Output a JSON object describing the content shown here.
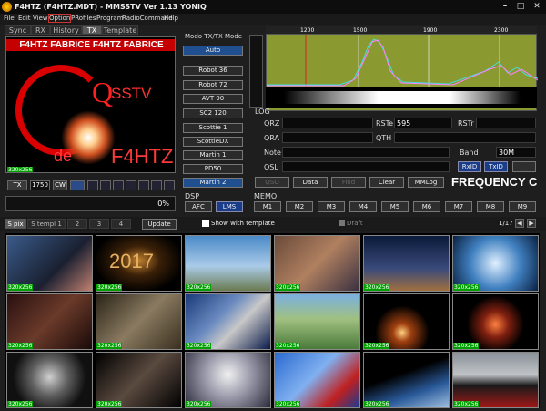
{
  "window": {
    "title": "F4HTZ (F4HTZ.MDT) - MMSSTV Ver 1.13 YONIQ",
    "min": "–",
    "max": "□",
    "close": "✕"
  },
  "menu": [
    "File",
    "Edit",
    "View",
    "Option",
    "PRofiles",
    "Program",
    "RadioCommand",
    "Help"
  ],
  "tabs": [
    "Sync",
    "RX",
    "History",
    "TX",
    "Template"
  ],
  "tx_image": {
    "banner": "F4HTZ  FABRICE  F4HTZ  FABRICE",
    "logo_q": "Q",
    "logo_sstv": "SSTV",
    "logo_de": "de",
    "callsign": "F4HTZ",
    "size": "320x256"
  },
  "tx_controls": {
    "tx": "TX",
    "freq": "1750",
    "cw": "CW",
    "percent": "0%"
  },
  "mode": {
    "title": "Modo TX/TX Mode",
    "items": [
      "Auto",
      "Robot 36",
      "Robot 72",
      "AVT 90",
      "SC2 120",
      "Scottie 1",
      "ScottieDX",
      "Martin 1",
      "PD50",
      "Martin 2"
    ],
    "selected": "Martin 2"
  },
  "spectrum": {
    "scale": [
      "1200",
      "1500",
      "1900",
      "2300"
    ]
  },
  "log": {
    "title": "LOG",
    "qrz_label": "QRZ",
    "rste_label": "RSTe",
    "rste_value": "595",
    "rstr_label": "RSTr",
    "qra_label": "QRA",
    "qth_label": "QTH",
    "note_label": "Note",
    "band_label": "Band",
    "band_value": "30M",
    "qsl_label": "QSL",
    "rxid": "RxID",
    "txid": "TxID"
  },
  "log_buttons": [
    "QSO",
    "Data",
    "Find",
    "Clear",
    "MMLog"
  ],
  "freq_banner": "FREQUENCY C",
  "dsp": {
    "title": "DSP",
    "afc": "AFC",
    "lms": "LMS"
  },
  "memo": {
    "title": "MEMO",
    "buttons": [
      "M1",
      "M2",
      "M3",
      "M4",
      "M5",
      "M6",
      "M7",
      "M8",
      "M9"
    ]
  },
  "bottom_tabs": [
    "S pix",
    "S templ 1",
    "2",
    "3",
    "4"
  ],
  "update": "Update",
  "show_template": "Show with template",
  "draft": "Draft",
  "page": "1/17",
  "thumbs": [
    {
      "size": "320x256"
    },
    {
      "size": "320x256"
    },
    {
      "size": "320x256"
    },
    {
      "size": "320x256"
    },
    {
      "size": "320x256"
    },
    {
      "size": "320x256"
    },
    {
      "size": "320x256"
    },
    {
      "size": "320x256"
    },
    {
      "size": "320x256"
    },
    {
      "size": "320x256"
    },
    {
      "size": "320x256"
    },
    {
      "size": "320x256"
    },
    {
      "size": "320x256"
    },
    {
      "size": "320x256"
    },
    {
      "size": "320x256"
    },
    {
      "size": "320x256"
    },
    {
      "size": "320x256"
    },
    {
      "size": "320x256"
    }
  ]
}
